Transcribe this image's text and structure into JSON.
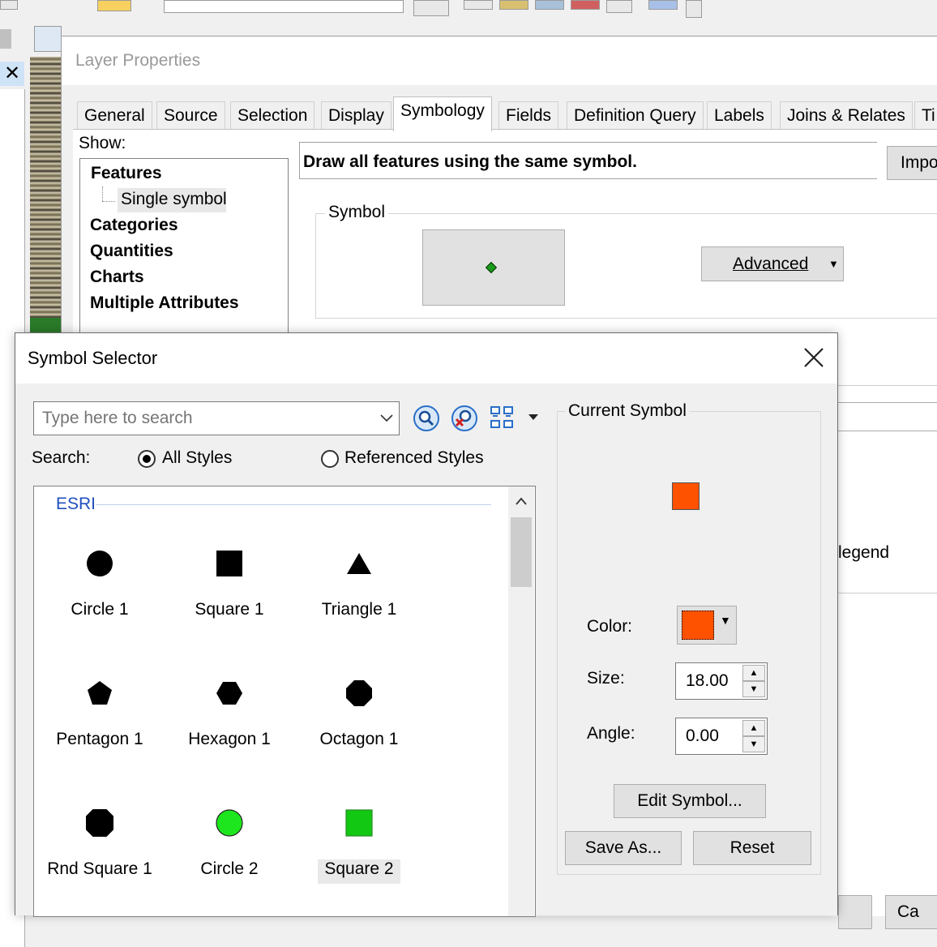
{
  "layer_properties": {
    "title": "Layer Properties",
    "tabs": [
      "General",
      "Source",
      "Selection",
      "Display",
      "Symbology",
      "Fields",
      "Definition Query",
      "Labels",
      "Joins & Relates",
      "Ti"
    ],
    "active_tab": "Symbology",
    "show_label": "Show:",
    "show_items": {
      "features": "Features",
      "single_symbol": "Single symbol",
      "categories": "Categories",
      "quantities": "Quantities",
      "charts": "Charts",
      "multiple_attributes": "Multiple Attributes"
    },
    "description": "Draw all features using the same symbol.",
    "import_label": "Impo",
    "symbol_group_label": "Symbol",
    "advanced_label": "Advanced",
    "legend_text": "legend",
    "cancel_label": "Ca"
  },
  "symbol_selector": {
    "title": "Symbol Selector",
    "search_placeholder": "Type here to search",
    "search_label": "Search:",
    "radio_all": "All Styles",
    "radio_referenced": "Referenced Styles",
    "selected_radio": "All Styles",
    "style_group": "ESRI",
    "symbols": [
      {
        "name": "Circle 1",
        "shape": "circle",
        "color": "#000000"
      },
      {
        "name": "Square 1",
        "shape": "square",
        "color": "#000000"
      },
      {
        "name": "Triangle 1",
        "shape": "triangle",
        "color": "#000000"
      },
      {
        "name": "Pentagon 1",
        "shape": "pentagon",
        "color": "#000000"
      },
      {
        "name": "Hexagon 1",
        "shape": "hexagon",
        "color": "#000000"
      },
      {
        "name": "Octagon 1",
        "shape": "octagon",
        "color": "#000000"
      },
      {
        "name": "Rnd Square 1",
        "shape": "round-square",
        "color": "#000000"
      },
      {
        "name": "Circle 2",
        "shape": "circle",
        "color": "#1ee61e"
      },
      {
        "name": "Square 2",
        "shape": "square",
        "color": "#12c812"
      }
    ],
    "current_symbol_label": "Current Symbol",
    "current_color": "#fe5200",
    "color_label": "Color:",
    "size_label": "Size:",
    "size_value": "18.00",
    "angle_label": "Angle:",
    "angle_value": "0.00",
    "edit_symbol_label": "Edit Symbol...",
    "save_as_label": "Save As...",
    "reset_label": "Reset"
  },
  "icons": {
    "search": "magnifier-icon",
    "clear_search": "clear-search-icon",
    "view_options": "view-options-icon",
    "close": "close-icon"
  }
}
